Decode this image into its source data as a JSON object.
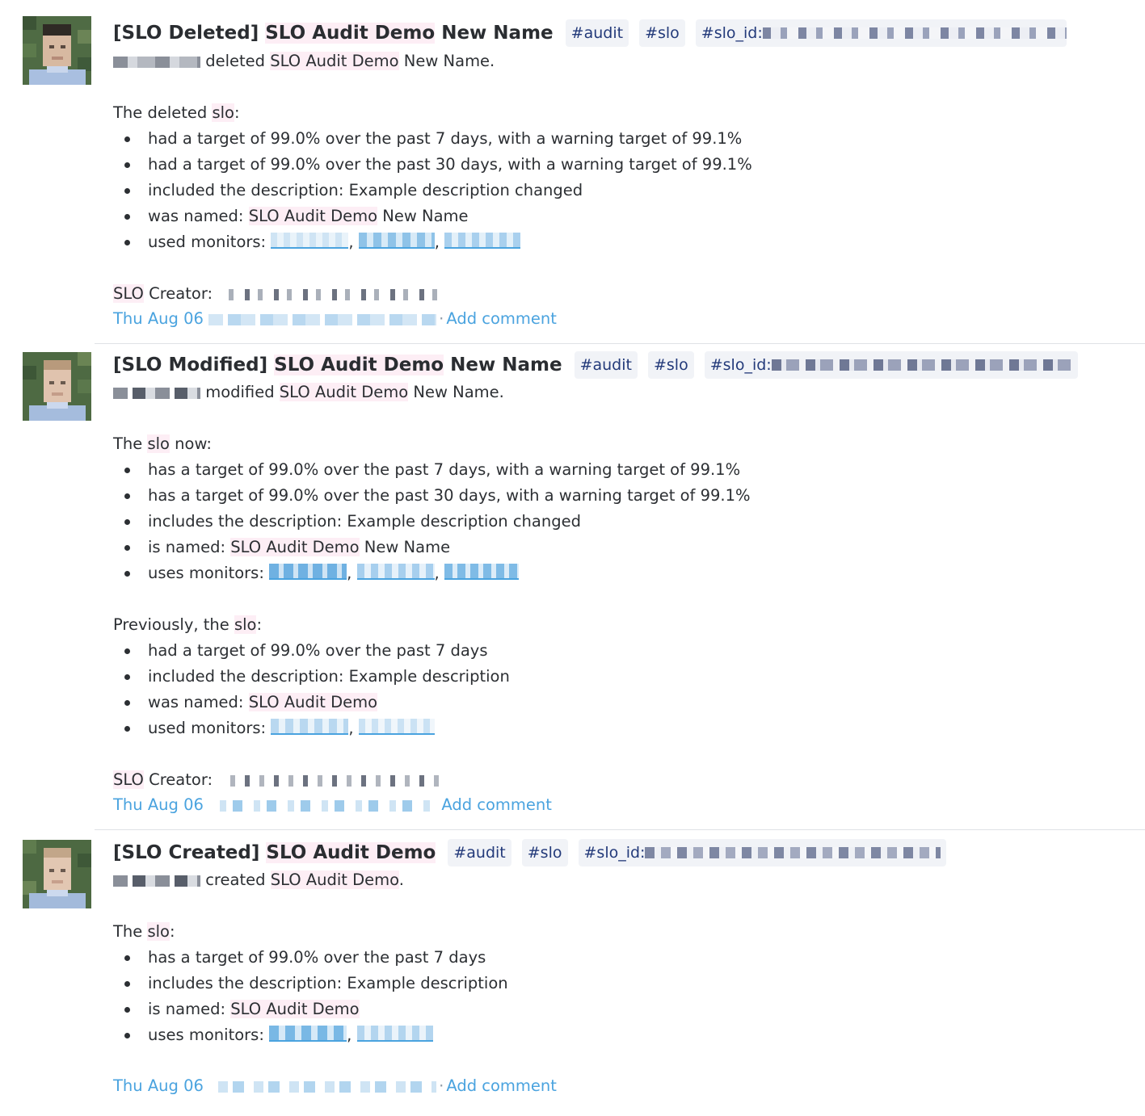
{
  "events": [
    {
      "title_prefix": "[SLO Deleted]",
      "title_name_hl": "SLO Audit Demo",
      "title_name_rest": "New Name",
      "tags": [
        "#audit",
        "#slo",
        "#slo_id:"
      ],
      "action_text": "deleted",
      "action_name_hl": "SLO Audit Demo",
      "action_name_rest": "New Name.",
      "section_label_pre": "The deleted ",
      "section_label_hl": "slo",
      "section_label_post": ":",
      "bullets": [
        "had a target of 99.0% over the past 7 days, with a warning target of 99.1%",
        "had a target of 99.0% over the past 30 days, with a warning target of 99.1%",
        "included the description: Example description changed"
      ],
      "named_label": "was named: ",
      "named_hl": "SLO Audit Demo",
      "named_rest": " New Name",
      "monitors_label": "used monitors: ",
      "creator_hl": "SLO",
      "creator_rest": " Creator:",
      "date": "Thu Aug 06",
      "add_comment": "Add comment"
    },
    {
      "title_prefix": "[SLO Modified]",
      "title_name_hl": "SLO Audit Demo",
      "title_name_rest": "New Name",
      "tags": [
        "#audit",
        "#slo",
        "#slo_id:"
      ],
      "action_text": "modified",
      "action_name_hl": "SLO Audit Demo",
      "action_name_rest": "New Name.",
      "section_label_pre": "The ",
      "section_label_hl": "slo",
      "section_label_post": " now:",
      "bullets": [
        "has a target of 99.0% over the past 7 days, with a warning target of 99.1%",
        "has a target of 99.0% over the past 30 days, with a warning target of 99.1%",
        "includes the description: Example description changed"
      ],
      "named_label": "is named: ",
      "named_hl": "SLO Audit Demo",
      "named_rest": " New Name",
      "monitors_label": "uses monitors: ",
      "prev_label_pre": "Previously, the ",
      "prev_label_hl": "slo",
      "prev_label_post": ":",
      "prev_bullets": [
        "had a target of 99.0% over the past 7 days",
        "included the description: Example description"
      ],
      "prev_named_label": "was named: ",
      "prev_named_hl": "SLO Audit Demo",
      "prev_monitors_label": "used monitors: ",
      "creator_hl": "SLO",
      "creator_rest": " Creator:",
      "date": "Thu Aug 06",
      "add_comment": "Add comment"
    },
    {
      "title_prefix": "[SLO Created]",
      "title_name_hl": "SLO Audit Demo",
      "tags": [
        "#audit",
        "#slo",
        "#slo_id:"
      ],
      "action_text": "created",
      "action_name_hl": "SLO Audit Demo",
      "action_name_rest": ".",
      "section_label_pre": "The ",
      "section_label_hl": "slo",
      "section_label_post": ":",
      "bullets": [
        "has a target of 99.0% over the past 7 days",
        "includes the description: Example description"
      ],
      "named_label": "is named: ",
      "named_hl": "SLO Audit Demo",
      "monitors_label": "uses monitors: ",
      "date": "Thu Aug 06",
      "add_comment": "Add comment"
    }
  ],
  "colors": {
    "link": "#4aa3df",
    "tag_text": "#233a7a",
    "tag_bg": "#f1f3f7",
    "highlight": "#fdeef5"
  }
}
